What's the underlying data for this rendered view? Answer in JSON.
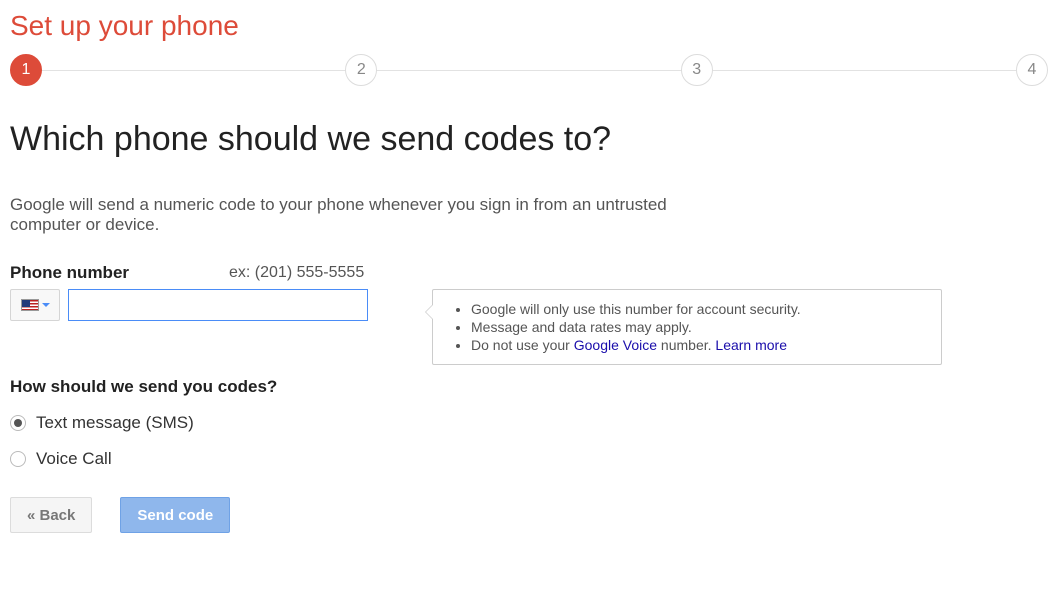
{
  "header": {
    "title": "Set up your phone"
  },
  "stepper": {
    "steps": [
      "1",
      "2",
      "3",
      "4"
    ],
    "active_index": 0
  },
  "main": {
    "heading": "Which phone should we send codes to?",
    "description": "Google will send a numeric code to your phone whenever you sign in from an untrusted computer or device.",
    "phone": {
      "label": "Phone number",
      "example": "ex: (201) 555-5555",
      "value": "",
      "country_code_name": "us-flag-icon"
    },
    "tooltip": {
      "item1": "Google will only use this number for account security.",
      "item2": "Message and data rates may apply.",
      "item3_prefix": "Do not use your ",
      "item3_link1": "Google Voice",
      "item3_mid": " number. ",
      "item3_link2": "Learn more"
    },
    "delivery": {
      "label": "How should we send you codes?",
      "option_sms": "Text message (SMS)",
      "option_voice": "Voice Call",
      "selected": "sms"
    },
    "buttons": {
      "back": "« Back",
      "send": "Send code"
    }
  }
}
